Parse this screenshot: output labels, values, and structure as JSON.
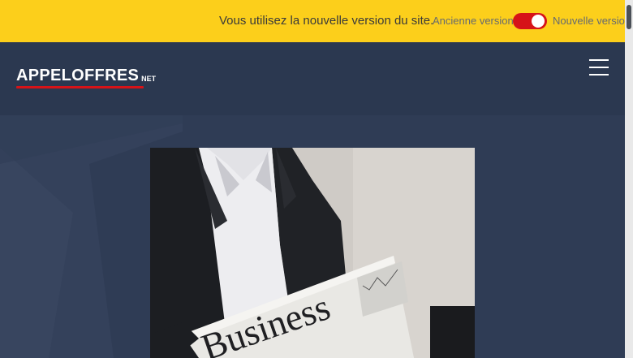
{
  "notice": {
    "message": "Vous utilisez la nouvelle version du site.",
    "old_version_label": "Ancienne version",
    "new_version_label": "Nouvelle version",
    "toggle_state": "on",
    "bar_color": "#fccf1b",
    "toggle_color": "#d61318"
  },
  "header": {
    "logo_text": "APPELOFFRES",
    "logo_suffix": "NET",
    "menu_icon": "hamburger-menu-icon",
    "background": "#2b3850",
    "accent": "#d61318"
  },
  "hero": {
    "image_content": "Man in dark suit and white shirt holding a newspaper titled Business",
    "newspaper_headline": "Business"
  }
}
